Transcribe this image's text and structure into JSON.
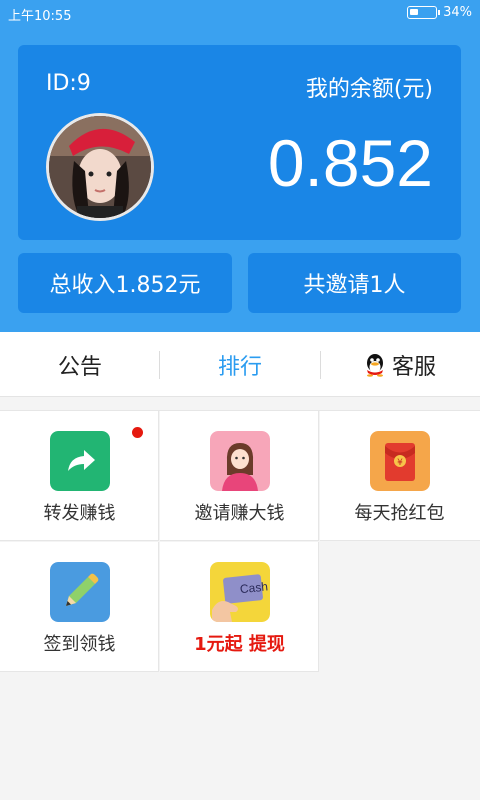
{
  "status_bar": {
    "time": "上午10:55",
    "battery": "34%"
  },
  "account": {
    "id_label": "ID:9",
    "balance_label": "我的余额(元)",
    "balance": "0.852",
    "total_income": "总收入1.852元",
    "invited": "共邀请1人"
  },
  "tabs": [
    {
      "label": "公告"
    },
    {
      "label": "排行"
    },
    {
      "label": "客服",
      "icon": "qq-penguin-icon"
    }
  ],
  "grid": [
    {
      "label": "转发赚钱",
      "icon": "share-arrow-icon",
      "badge": true
    },
    {
      "label": "邀请赚大钱",
      "icon": "invite-person-icon"
    },
    {
      "label": "每天抢红包",
      "icon": "red-envelope-icon"
    },
    {
      "label": "签到领钱",
      "icon": "pencil-icon"
    },
    {
      "label": "1元起 提现",
      "icon": "cash-card-icon",
      "highlight": true
    }
  ],
  "colors": {
    "primary": "#3aa1f0",
    "card": "#1a86e6",
    "active_tab": "#2b9cf0",
    "accent_red": "#e5190f"
  }
}
